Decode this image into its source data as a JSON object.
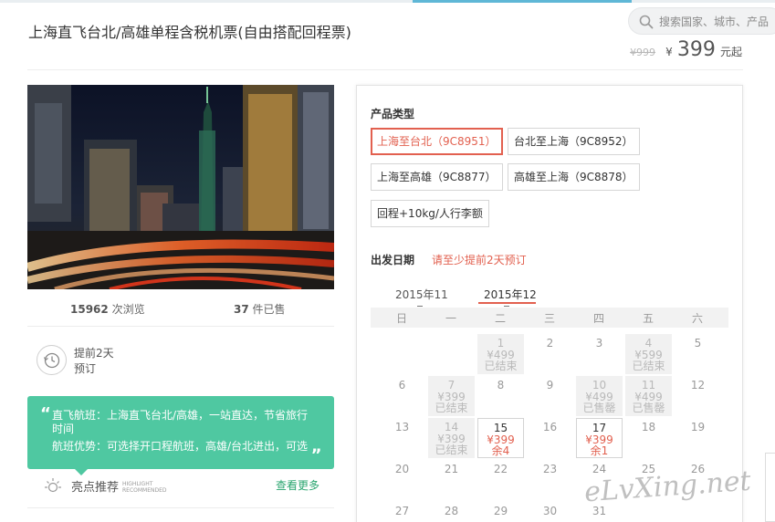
{
  "header": {
    "title": "上海直飞台北/高雄单程含税机票(自由搭配回程票)",
    "search_placeholder": "搜索国家、城市、产品",
    "old_price": "¥999",
    "currency": "¥",
    "price": "399",
    "price_unit": "元起"
  },
  "stats": {
    "views": "15962",
    "views_label": "次浏览",
    "sold": "37",
    "sold_label": "件已售"
  },
  "advance": {
    "line1": "提前2天",
    "line2": "预订"
  },
  "highlight": {
    "open_quote": "“",
    "close_quote": "„",
    "text1": "直飞航班：上海直飞台北/高雄，一站直达，节省旅行时间",
    "text2": "航班优势：可选择开口程航班，高雄/台北进出，可选",
    "label": "亮点推荐",
    "label_en1": "HIGHLIGHT",
    "label_en2": "RECOMMENDED",
    "more": "查看更多"
  },
  "product": {
    "label": "产品类型",
    "options": [
      {
        "label": "上海至台北（9C8951）",
        "selected": true
      },
      {
        "label": "台北至上海（9C8952）",
        "selected": false
      },
      {
        "label": "上海至高雄（9C8877）",
        "selected": false
      },
      {
        "label": "高雄至上海（9C8878）",
        "selected": false
      },
      {
        "label": "回程+10kg/人行李额",
        "selected": false
      }
    ]
  },
  "date": {
    "label": "出发日期",
    "notice": "请至少提前2天预订",
    "months": [
      "2015年11",
      "2015年12"
    ],
    "weekdays": [
      "日",
      "一",
      "二",
      "三",
      "四",
      "五",
      "六"
    ],
    "days": [
      {
        "day": "1",
        "price": "¥499",
        "status": "已结束",
        "kind": "gray"
      },
      {
        "day": "2",
        "price": "",
        "status": "",
        "kind": "plain"
      },
      {
        "day": "3",
        "price": "",
        "status": "",
        "kind": "plain"
      },
      {
        "day": "4",
        "price": "¥599",
        "status": "已结束",
        "kind": "gray"
      },
      {
        "day": "5",
        "price": "",
        "status": "",
        "kind": "plain"
      },
      {
        "day": "6",
        "price": "",
        "status": "",
        "kind": "plain"
      },
      {
        "day": "7",
        "price": "¥399",
        "status": "已结束",
        "kind": "gray"
      },
      {
        "day": "8",
        "price": "",
        "status": "",
        "kind": "plain"
      },
      {
        "day": "9",
        "price": "",
        "status": "",
        "kind": "plain"
      },
      {
        "day": "10",
        "price": "¥499",
        "status": "已售罄",
        "kind": "gray"
      },
      {
        "day": "11",
        "price": "¥499",
        "status": "已售罄",
        "kind": "gray"
      },
      {
        "day": "12",
        "price": "",
        "status": "",
        "kind": "plain"
      },
      {
        "day": "13",
        "price": "",
        "status": "",
        "kind": "plain"
      },
      {
        "day": "14",
        "price": "¥399",
        "status": "已结束",
        "kind": "gray"
      },
      {
        "day": "15",
        "price": "¥399",
        "status": "余4",
        "kind": "act"
      },
      {
        "day": "16",
        "price": "",
        "status": "",
        "kind": "plain"
      },
      {
        "day": "17",
        "price": "¥399",
        "status": "余1",
        "kind": "act"
      },
      {
        "day": "18",
        "price": "",
        "status": "",
        "kind": "plain"
      },
      {
        "day": "19",
        "price": "",
        "status": "",
        "kind": "plain"
      },
      {
        "day": "20",
        "price": "",
        "status": "",
        "kind": "plain"
      },
      {
        "day": "21",
        "price": "",
        "status": "",
        "kind": "plain"
      },
      {
        "day": "22",
        "price": "",
        "status": "",
        "kind": "plain"
      },
      {
        "day": "23",
        "price": "",
        "status": "",
        "kind": "plain"
      },
      {
        "day": "24",
        "price": "",
        "status": "",
        "kind": "plain"
      },
      {
        "day": "25",
        "price": "",
        "status": "",
        "kind": "plain"
      },
      {
        "day": "26",
        "price": "",
        "status": "",
        "kind": "plain"
      },
      {
        "day": "27",
        "price": "",
        "status": "",
        "kind": "plain"
      },
      {
        "day": "28",
        "price": "",
        "status": "",
        "kind": "plain"
      },
      {
        "day": "29",
        "price": "",
        "status": "",
        "kind": "plain"
      },
      {
        "day": "30",
        "price": "",
        "status": "",
        "kind": "plain"
      },
      {
        "day": "31",
        "price": "",
        "status": "",
        "kind": "plain"
      }
    ]
  },
  "watermark": "eLvXing.net",
  "colors": {
    "accent": "#e2604f",
    "green": "#4fc8a1",
    "more_link": "#2aa56f"
  }
}
